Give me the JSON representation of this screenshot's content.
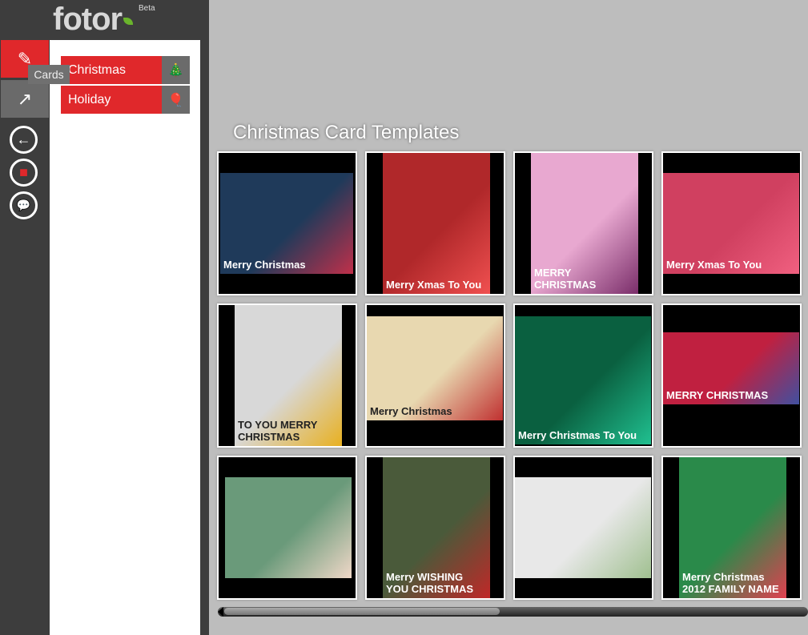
{
  "app": {
    "logo": "fotor",
    "beta": "Beta"
  },
  "rail": {
    "tooltip": "Cards"
  },
  "categories": [
    {
      "label": "Christmas",
      "icon": "tree-icon"
    },
    {
      "label": "Holiday",
      "icon": "balloon-icon"
    }
  ],
  "main": {
    "title": "Christmas Card Templates"
  },
  "cards": [
    {
      "text": "Merry Christmas",
      "bg": "#1f3a5a",
      "accent": "#c0304a"
    },
    {
      "text": "Merry Xmas To You",
      "bg": "#b0282a",
      "accent": "#f05050"
    },
    {
      "text": "MERRY CHRISTMAS",
      "bg": "#e8a8d0",
      "accent": "#7a2e6a"
    },
    {
      "text": "Merry Xmas To You",
      "bg": "#d04060",
      "accent": "#f06080"
    },
    {
      "text": "TO YOU MERRY CHRISTMAS",
      "bg": "#d8d8d8",
      "accent": "#e8b020"
    },
    {
      "text": "Merry Christmas",
      "bg": "#e8d8b0",
      "accent": "#c03030"
    },
    {
      "text": "Merry Christmas To You",
      "bg": "#0a6040",
      "accent": "#20c090"
    },
    {
      "text": "MERRY CHRISTMAS",
      "bg": "#c02040",
      "accent": "#4050a0"
    },
    {
      "text": "",
      "bg": "#6a9a7a",
      "accent": "#f0d8c8"
    },
    {
      "text": "Merry WISHING YOU CHRISTMAS",
      "bg": "#4a5a3a",
      "accent": "#c02828"
    },
    {
      "text": "",
      "bg": "#e8e8e8",
      "accent": "#a0c090"
    },
    {
      "text": "Merry Christmas 2012 FAMILY NAME",
      "bg": "#2a8a4a",
      "accent": "#e04050"
    }
  ]
}
